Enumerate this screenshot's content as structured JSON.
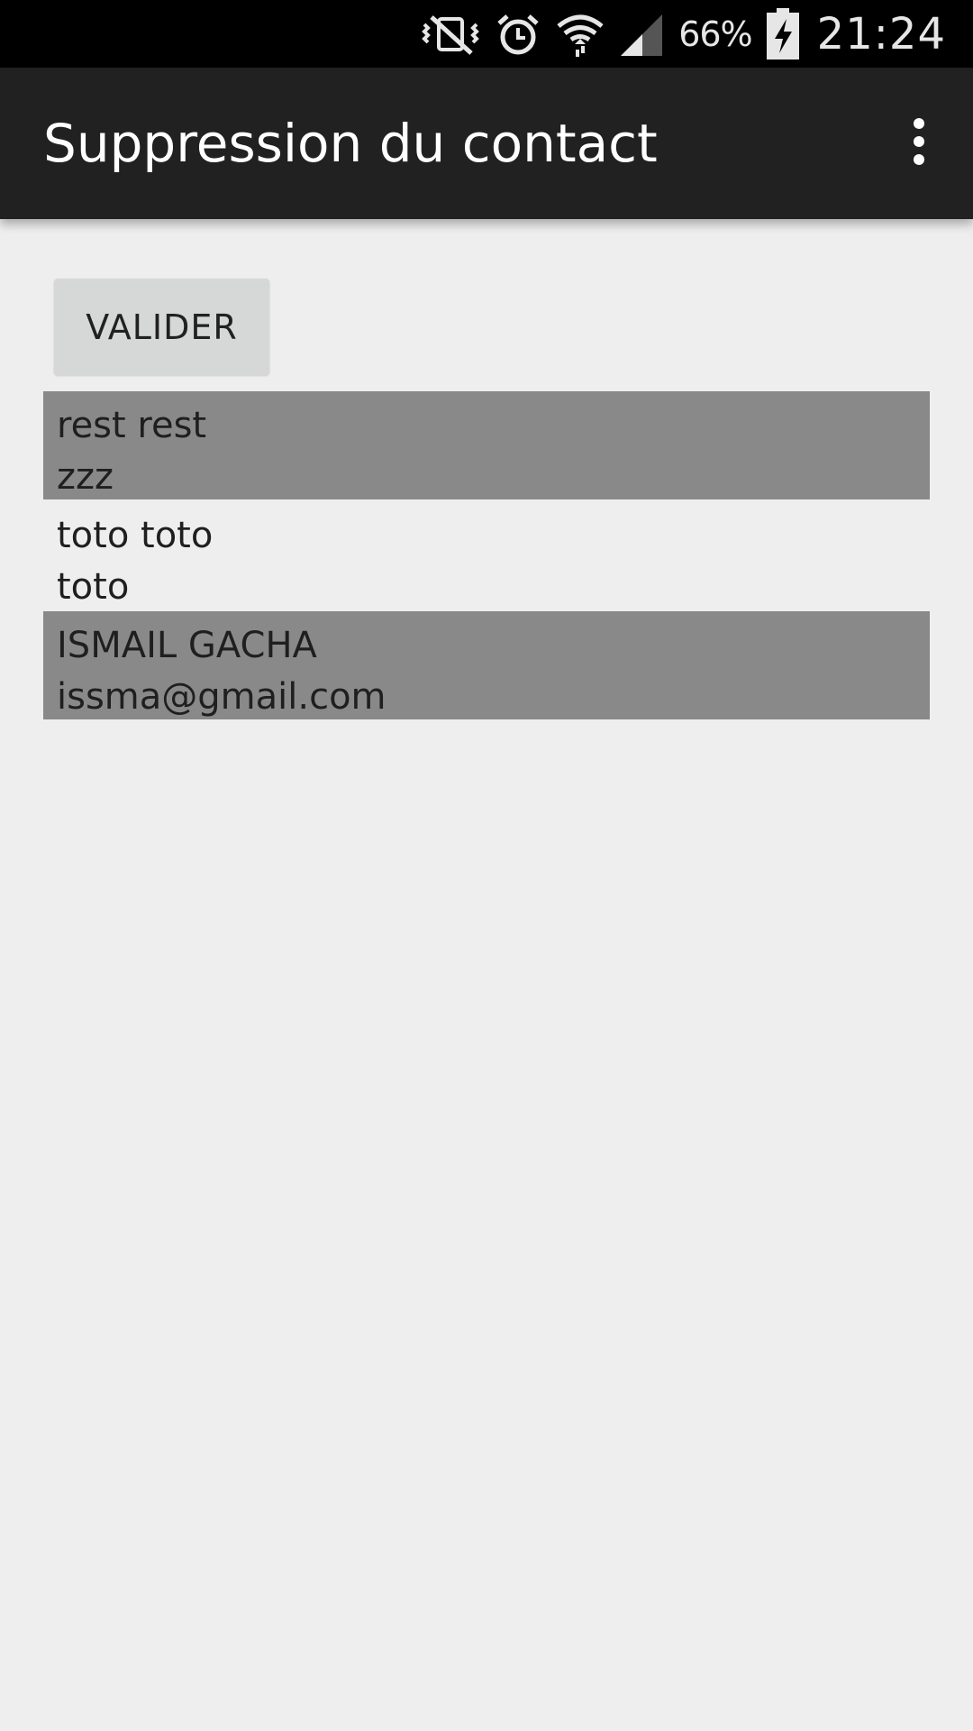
{
  "status_bar": {
    "battery_percent": "66%",
    "time": "21:24",
    "icons": [
      "vibrate-off-icon",
      "alarm-icon",
      "wifi-icon",
      "cell-signal-icon",
      "battery-charging-icon"
    ]
  },
  "action_bar": {
    "title": "Suppression du contact",
    "overflow_icon": "overflow-menu-icon"
  },
  "main": {
    "validate_label": "VALIDER",
    "contacts": [
      {
        "name": "rest rest",
        "detail": "zzz",
        "selected": true
      },
      {
        "name": "toto toto",
        "detail": "toto",
        "selected": false
      },
      {
        "name": "ISMAIL GACHA",
        "detail": "issma@gmail.com",
        "selected": true
      }
    ]
  },
  "colors": {
    "status_bar_bg": "#000000",
    "action_bar_bg": "#212121",
    "page_bg": "#eeeeee",
    "selected_row_bg": "#898989",
    "button_bg": "#d6d7d7"
  }
}
